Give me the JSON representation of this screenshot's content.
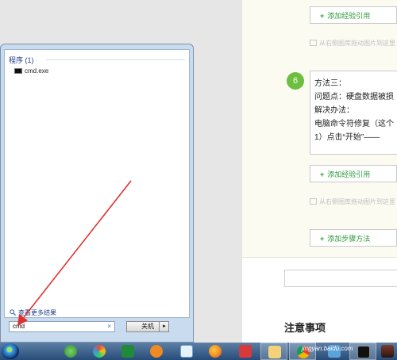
{
  "page": {
    "add_ref_1": "添加经验引用",
    "hint_1": "从右侧图库拖动图片到这里",
    "step": {
      "number": "6",
      "lines": [
        "方法三：",
        "问题点：硬盘数据被损",
        "解决办法：",
        "电脑命令符修复（这个",
        "1）点击“开始”——"
      ]
    },
    "add_ref_2": "添加经验引用",
    "hint_2": "从右侧图库拖动图片到这里",
    "add_step": "添加步骤方法",
    "notes_title": "注意事项"
  },
  "start_menu": {
    "programs_header": "程序 (1)",
    "result_item": "cmd.exe",
    "see_more": "查看更多结果",
    "search_value": "cmd",
    "clear_symbol": "×",
    "shutdown_label": "关机",
    "shutdown_arrow": "▸"
  },
  "taskbar": {
    "watermark": "jingyan.baidu.com",
    "icons": [
      "start-orb",
      "media-player-icon",
      "browser-icon",
      "spreadsheet-icon",
      "sogou-icon",
      "cloud-icon",
      "firefox-icon",
      "avatar-app-icon",
      "explorer-icon",
      "chrome-icon",
      "photo-viewer-icon",
      "terminal-icon"
    ]
  },
  "colors": {
    "accent_green": "#6cbf3f",
    "link_green": "#2e9b3c",
    "taskbar": "#274c78",
    "arrow": "#e03030"
  }
}
